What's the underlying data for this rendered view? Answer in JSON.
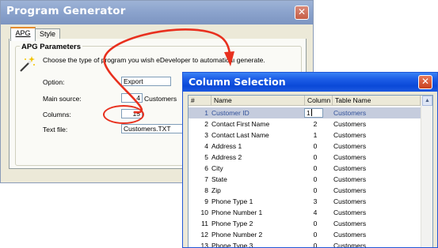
{
  "colors": {
    "arrow": "#e8301e",
    "cs_titlebar": "#0a49d8",
    "pg_titlebar": "#8aa2cc",
    "selection": "#c5ccdd",
    "tab_highlight": "#e68b2c"
  },
  "program_generator": {
    "title": "Program Generator",
    "close_icon": "close-icon",
    "tabs": [
      {
        "label": "APG",
        "active": true
      },
      {
        "label": "Style",
        "active": false
      }
    ],
    "group_title": "APG Parameters",
    "description": "Choose the type of program you wish eDeveloper to automaticaı  generate.",
    "fields": {
      "option": {
        "label": "Option:",
        "value": "Export"
      },
      "main_source": {
        "label": "Main source:",
        "value": "4",
        "suffix": "Customers"
      },
      "columns": {
        "label": "Columns:",
        "value": "15"
      },
      "text_file": {
        "label": "Text file:",
        "value": "Customers.TXT"
      }
    }
  },
  "column_selection": {
    "title": "Column Selection",
    "close_icon": "close-icon",
    "headers": {
      "num": "#",
      "name": "Name",
      "column": "Column",
      "table": "Table Name"
    },
    "rows": [
      {
        "num": "1",
        "name": "Customer ID",
        "column": "1",
        "table": "Customers",
        "selected": true
      },
      {
        "num": "2",
        "name": "Contact First Name",
        "column": "2",
        "table": "Customers"
      },
      {
        "num": "3",
        "name": "Contact Last Name",
        "column": "1",
        "table": "Customers"
      },
      {
        "num": "4",
        "name": "Address 1",
        "column": "0",
        "table": "Customers"
      },
      {
        "num": "5",
        "name": "Address 2",
        "column": "0",
        "table": "Customers"
      },
      {
        "num": "6",
        "name": "City",
        "column": "0",
        "table": "Customers"
      },
      {
        "num": "7",
        "name": "State",
        "column": "0",
        "table": "Customers"
      },
      {
        "num": "8",
        "name": "Zip",
        "column": "0",
        "table": "Customers"
      },
      {
        "num": "9",
        "name": "Phone Type 1",
        "column": "3",
        "table": "Customers"
      },
      {
        "num": "10",
        "name": "Phone Number 1",
        "column": "4",
        "table": "Customers"
      },
      {
        "num": "11",
        "name": "Phone Type 2",
        "column": "0",
        "table": "Customers"
      },
      {
        "num": "12",
        "name": "Phone Number 2",
        "column": "0",
        "table": "Customers"
      },
      {
        "num": "13",
        "name": "Phone Type 3",
        "column": "0",
        "table": "Customers"
      }
    ]
  }
}
